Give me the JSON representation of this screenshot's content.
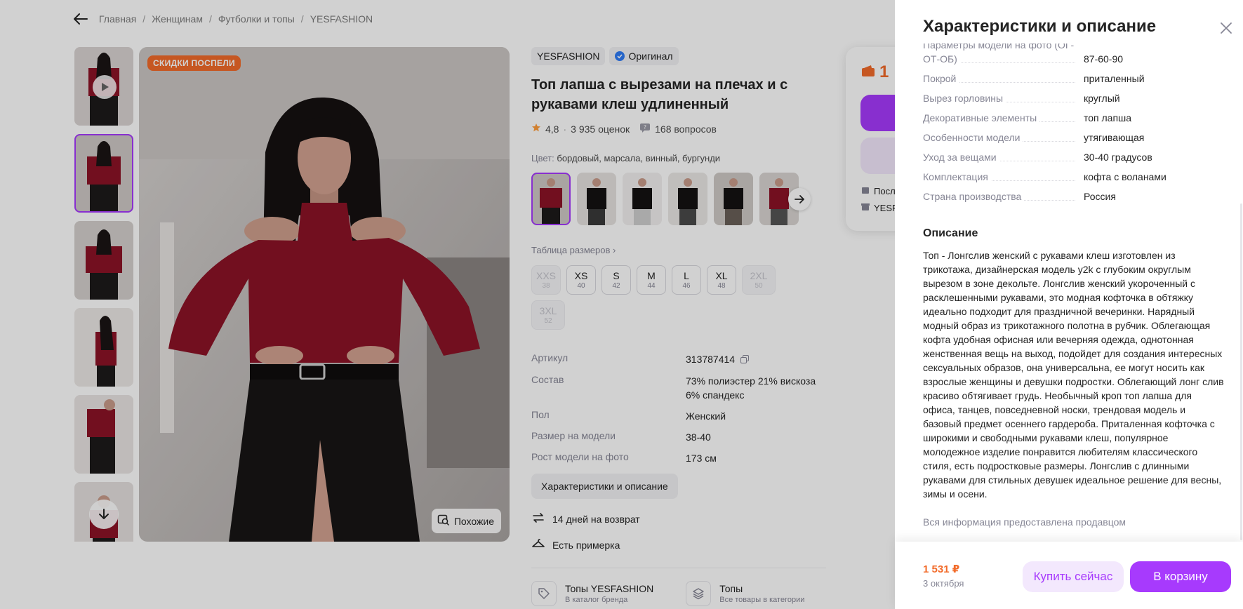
{
  "breadcrumbs": [
    "Главная",
    "Женщинам",
    "Футболки и топы",
    "YESFASHION"
  ],
  "product": {
    "promo_badge": "СКИДКИ ПОСПЕЛИ",
    "similar_label": "Похожие",
    "brand": "YESFASHION",
    "original_label": "Оригинал",
    "title": "Топ лапша с вырезами на плечах и с рукавами клеш удлиненный",
    "rating": "4,8",
    "reviews": "3 935 оценок",
    "questions": "168 вопросов",
    "color_label": "Цвет:",
    "color_value": "бордовый, марсала, винный, бургунди",
    "size_table_label": "Таблица размеров",
    "sizes": [
      {
        "s": "XXS",
        "n": "38",
        "available": false
      },
      {
        "s": "XS",
        "n": "40",
        "available": true
      },
      {
        "s": "S",
        "n": "42",
        "available": true
      },
      {
        "s": "M",
        "n": "44",
        "available": true
      },
      {
        "s": "L",
        "n": "46",
        "available": true
      },
      {
        "s": "XL",
        "n": "48",
        "available": true
      },
      {
        "s": "2XL",
        "n": "50",
        "available": false
      },
      {
        "s": "3XL",
        "n": "52",
        "available": false
      }
    ],
    "params": [
      {
        "k": "Артикул",
        "v": "313787414"
      },
      {
        "k": "Состав",
        "v": "73% полиэстер 21% вискоза 6% спандекс"
      },
      {
        "k": "Пол",
        "v": "Женский"
      },
      {
        "k": "Размер на модели",
        "v": "38-40"
      },
      {
        "k": "Рост модели на фото",
        "v": "173 см"
      }
    ],
    "char_button": "Характеристики и описание",
    "return_label": "14 дней на возврат",
    "fitting_label": "Есть примерка",
    "brand_link": {
      "title": "Топы YESFASHION",
      "sub": "В каталог бренда"
    },
    "category_link": {
      "title": "Топы",
      "sub": "Все товары в категории"
    },
    "buy_card_price_peek": "1",
    "buy_card_line1": "Посл",
    "buy_card_line2": "YESF"
  },
  "panel": {
    "title": "Характеристики и описание",
    "characteristics": [
      {
        "k": "Параметры модели на фото (ОГ-ОТ-ОБ)",
        "v": "87-60-90"
      },
      {
        "k": "Покрой",
        "v": "приталенный"
      },
      {
        "k": "Вырез горловины",
        "v": "круглый"
      },
      {
        "k": "Декоративные элементы",
        "v": "топ лапша"
      },
      {
        "k": "Особенности модели",
        "v": "утягивающая"
      },
      {
        "k": "Уход за вещами",
        "v": "30-40 градусов"
      },
      {
        "k": "Комплектация",
        "v": "кофта с воланами"
      },
      {
        "k": "Страна производства",
        "v": "Россия"
      }
    ],
    "description_title": "Описание",
    "description": "Топ - Лонгслив женский с рукавами клеш изготовлен из трикотажа, дизайнерская модель y2k с глубоким округлым вырезом в зоне декольте. Лонгслив женский укороченный с расклешенными рукавами, это модная кофточка в обтяжку идеально подходит для праздничной вечеринки. Нарядный модный образ из трикотажного полотна в рубчик. Облегающая кофта удобная офисная или вечерняя одежда, однотонная женственная вещь на выход, подойдет для создания интересных сексуальных образов, она универсальна, ее могут носить как взрослые женщины и девушки подростки. Облегающий лонг слив красиво обтягивает грудь. Необычный кроп топ лапша для офиса, танцев, повседневной носки, трендовая модель и базовый предмет осеннего гардероба. Приталенная кофточка с широкими и свободными рукавами клеш, популярное молодежное изделие понравится любителям классического стиля, есть подростковые размеры. Лонгслив с длинными рукавами для стильных девушек идеальное решение для весны, зимы и осени.",
    "seller_note": "Вся информация предоставлена продавцом",
    "footer": {
      "price": "1 531 ₽",
      "date": "3 октября",
      "buy_now": "Купить сейчас",
      "add_to_cart": "В корзину"
    }
  },
  "colors": {
    "accent": "#a73afd",
    "accent_light": "#f3e8fd",
    "price": "#f26b2a",
    "top_color": "#8b1326"
  }
}
